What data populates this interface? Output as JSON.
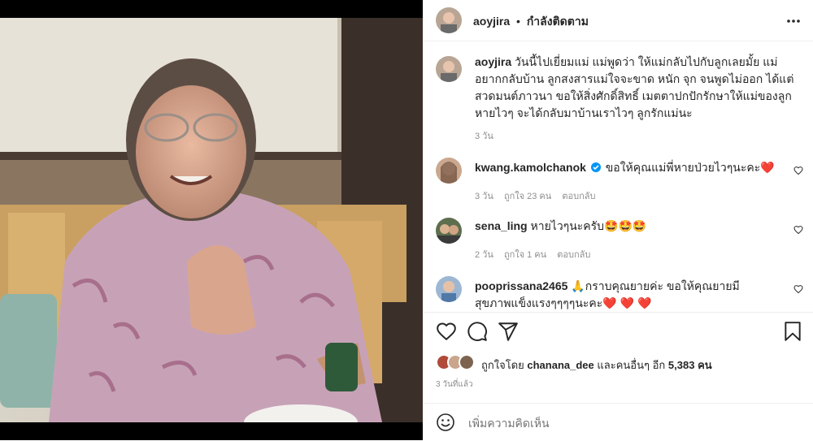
{
  "header": {
    "username": "aoyjira",
    "separator": "•",
    "follow_label": "กำลังติดตาม",
    "more_icon": "more-icon"
  },
  "caption": {
    "username": "aoyjira",
    "text": "วันนี้ไปเยี่ยมแม่ แม่พูดว่า ให้แม่กลับไปกับลูกเลยมั้ย แม่อยากกลับบ้าน ลูกสงสารแม่ใจจะขาด หนัก จุก จนพูดไม่ออก ได้แต่สวดมนต์ภาวนา ขอให้สิ่งศักดิ์สิทธิ์ เมตตาปกปักรักษาให้แม่ของลูกหายไวๆ จะได้กลับมาบ้านเราไวๆ ลูกรักแม่นะ",
    "time": "3 วัน"
  },
  "comments": [
    {
      "username": "kwang.kamolchanok",
      "verified": true,
      "text": "ขอให้คุณแม่พี่หายป่วยไวๆนะคะ",
      "emoji": "❤️",
      "time": "3 วัน",
      "likes": "ถูกใจ 23 คน",
      "reply": "ตอบกลับ"
    },
    {
      "username": "sena_ling",
      "verified": false,
      "text": "หายไวๆนะครับ",
      "emoji": "🤩🤩🤩",
      "time": "2 วัน",
      "likes": "ถูกใจ 1 คน",
      "reply": "ตอบกลับ"
    },
    {
      "username": "pooprissana2465",
      "verified": false,
      "text": "🙏กราบคุณยายค่ะ ขอให้คุณยายมีสุขภาพแข็งแรงๆๆๆๆนะคะ",
      "emoji": "❤️ ❤️ ❤️",
      "time": "",
      "likes": "",
      "reply": ""
    }
  ],
  "actions": {
    "like": "heart-icon",
    "comment": "comment-icon",
    "share": "share-icon",
    "save": "bookmark-icon"
  },
  "likes_line": {
    "prefix": "ถูกใจโดย",
    "user": "chanana_dee",
    "middle": "และคนอื่นๆ อีก",
    "count": "5,383",
    "suffix": "คน"
  },
  "post_time": "3 วันที่แล้ว",
  "add_comment": {
    "placeholder": "เพิ่มความคิดเห็น",
    "emoji_icon": "smiley-icon"
  },
  "colors": {
    "verified": "#0095f6",
    "heart": "#ed4956",
    "muted": "#8e8e8e"
  }
}
